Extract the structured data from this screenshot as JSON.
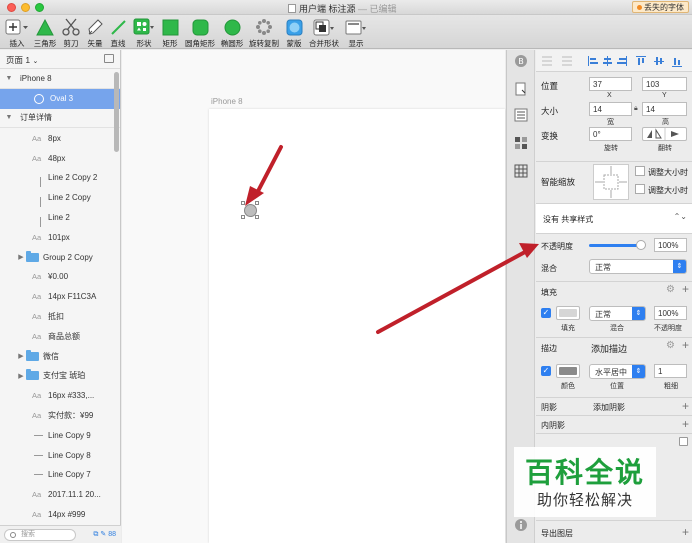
{
  "window": {
    "title": "用户端 标注源",
    "edited_suffix": "— 已编辑",
    "missing_fonts_badge": "丢失的字体"
  },
  "toolbar": {
    "tools": [
      {
        "label": "插入",
        "icon": "plus-dropdown-icon"
      },
      {
        "label": "三角形",
        "icon": "triangle-icon"
      },
      {
        "label": "剪刀",
        "icon": "scissors-icon"
      },
      {
        "label": "矢量",
        "icon": "vector-pen-icon"
      },
      {
        "label": "直线",
        "icon": "line-icon"
      },
      {
        "label": "形状",
        "icon": "shapes-icon"
      },
      {
        "label": "矩形",
        "icon": "rectangle-icon"
      },
      {
        "label": "圆角矩形",
        "icon": "rounded-rectangle-icon"
      },
      {
        "label": "椭圆形",
        "icon": "oval-icon"
      },
      {
        "label": "旋转复制",
        "icon": "rotate-copy-icon"
      },
      {
        "label": "蒙版",
        "icon": "mask-icon"
      },
      {
        "label": "合并形状",
        "icon": "combine-shapes-icon"
      },
      {
        "label": "显示",
        "icon": "view-icon"
      }
    ]
  },
  "layers": {
    "page_label": "页面 1",
    "items": [
      {
        "label": "iPhone 8",
        "kind": "artboard",
        "indent": 0
      },
      {
        "label": "Oval 3",
        "kind": "oval",
        "indent": 1,
        "selected": true
      },
      {
        "label": "订单详情",
        "kind": "artboard",
        "indent": 0
      },
      {
        "label": "8px",
        "kind": "text",
        "indent": 1
      },
      {
        "label": "48px",
        "kind": "text",
        "indent": 1
      },
      {
        "label": "Line 2 Copy 2",
        "kind": "vline",
        "indent": 1
      },
      {
        "label": "Line 2 Copy",
        "kind": "vline",
        "indent": 1
      },
      {
        "label": "Line 2",
        "kind": "vline",
        "indent": 1
      },
      {
        "label": "101px",
        "kind": "text",
        "indent": 1
      },
      {
        "label": "Group 2 Copy",
        "kind": "group",
        "indent": 1
      },
      {
        "label": "¥0.00",
        "kind": "text",
        "indent": 1
      },
      {
        "label": "14px F11C3A",
        "kind": "text",
        "indent": 1
      },
      {
        "label": "抵扣",
        "kind": "text",
        "indent": 1
      },
      {
        "label": "商品总额",
        "kind": "text",
        "indent": 1
      },
      {
        "label": "微信",
        "kind": "group",
        "indent": 1
      },
      {
        "label": "支付宝 琥珀",
        "kind": "group",
        "indent": 1
      },
      {
        "label": "16px #333,...",
        "kind": "text",
        "indent": 1
      },
      {
        "label": "实付款：¥99",
        "kind": "text",
        "indent": 1
      },
      {
        "label": "Line Copy 9",
        "kind": "hline",
        "indent": 1
      },
      {
        "label": "Line Copy 8",
        "kind": "hline",
        "indent": 1
      },
      {
        "label": "Line Copy 7",
        "kind": "hline",
        "indent": 1
      },
      {
        "label": "2017.11.1 20...",
        "kind": "text",
        "indent": 1
      },
      {
        "label": "14px #999",
        "kind": "text",
        "indent": 1
      }
    ],
    "search_placeholder": "搜索",
    "count": "88"
  },
  "canvas": {
    "artboard_label": "iPhone 8"
  },
  "inspector": {
    "position_label": "位置",
    "x_value": "37",
    "y_value": "103",
    "x_caption": "X",
    "y_caption": "Y",
    "size_label": "大小",
    "width_value": "14",
    "height_value": "14",
    "width_caption": "宽",
    "height_caption": "高",
    "transform_label": "变换",
    "rotate_value": "0°",
    "rotate_caption": "旋转",
    "flip_caption": "翻转",
    "resizing_label": "智能缩放",
    "fix_width_label": "调整大小时",
    "fix_height_label": "调整大小时",
    "shared_style": "没有 共享样式",
    "opacity_label": "不透明度",
    "opacity_value": "100%",
    "opacity_level": 1.0,
    "blend_label": "混合",
    "blend_value": "正常",
    "fill_section": "填充",
    "fill_blend_value": "正常",
    "fill_opacity_value": "100%",
    "fill_caption": "填充",
    "fill_blend_caption": "混合",
    "fill_opacity_caption": "不透明度",
    "fill_color": "#d6d6d6",
    "border_section": "描边",
    "add_border": "添加描边",
    "border_position_value": "水平居中",
    "border_width_value": "1",
    "border_color_caption": "颜色",
    "border_position_caption": "位置",
    "border_width_caption": "粗细",
    "border_color": "#8a8a8a",
    "shadow_section": "阴影",
    "add_shadow": "添加阴影",
    "inner_shadow_section": "内阴影",
    "export_label": "导出图层"
  },
  "watermark": {
    "title": "百科全说",
    "subtitle": "助你轻松解决"
  },
  "colors": {
    "selection": "#76a4ec",
    "accent": "#2e7ff0",
    "arrow": "#c0202a",
    "brand_green": "#1e9f3c"
  }
}
